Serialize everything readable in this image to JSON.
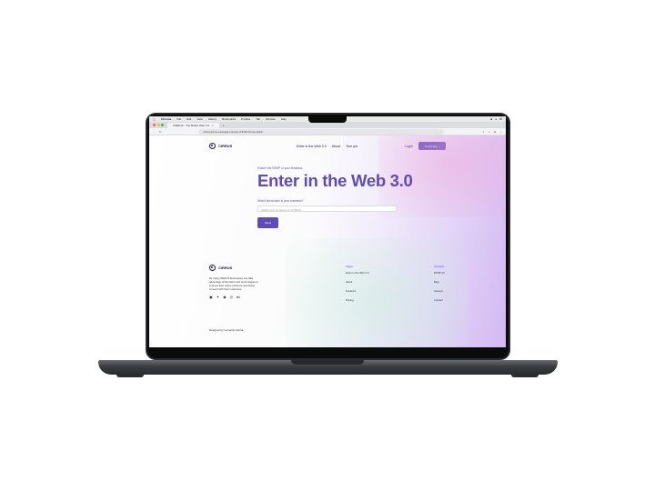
{
  "menubar": {
    "app": "Chrome",
    "items": [
      "File",
      "Edit",
      "View",
      "History",
      "Bookmarks",
      "Profiles",
      "Tab",
      "Window",
      "Help"
    ]
  },
  "browser": {
    "tab_title": "CIRRUS - The Better Web 3.0",
    "url": "cirrus.demo.example.com/en-US?id=cirrus-web3",
    "dot_colors": [
      "#ff5f57",
      "#febc2e",
      "#28c840"
    ]
  },
  "site": {
    "brand": "CIRRUS",
    "nav": [
      "Enter in the Web 3.0",
      "About",
      "Tour pro"
    ],
    "login": "Login",
    "signup": "Try for free"
  },
  "hero": {
    "eyebrow": "Ensure the NFMP of your business",
    "title": "Enter in the Web 3.0",
    "field_label": "Which blockchain is your business?",
    "input_placeholder": "Select your company to CITRUS",
    "submit": "Send"
  },
  "footer": {
    "brand": "CIRRUS",
    "description": "By using CIRRUS businesses can take advantage of the latest web technologies to improve their online presence and better connect with their customers.",
    "socials": [
      "instagram-icon",
      "twitter-icon",
      "github-icon",
      "dribbble-icon",
      "linkedin-icon"
    ],
    "pages_head": "Pages",
    "pages": [
      "Enter in the Web 3.0",
      "About",
      "Features",
      "Pricing"
    ],
    "contacts_head": "Contacts",
    "contacts": [
      "RTMP-IO",
      "Blog",
      "Careers",
      "Contact"
    ],
    "credits": "Designed by Leonardo Garcia"
  }
}
